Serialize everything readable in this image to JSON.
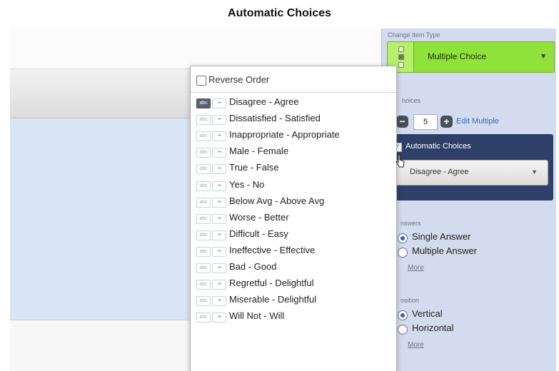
{
  "caption": "Automatic Choices",
  "panel": {
    "change_item_type_label": "Change Item Type",
    "item_type": "Multiple Choice",
    "choices_label": "hoices",
    "choices_count": "5",
    "edit_multiple": "Edit Multiple",
    "automatic_choices_label": "Automatic Choices",
    "automatic_choices_value": "Disagree - Agree",
    "answers_label": "nswers",
    "answer_options": [
      {
        "label": "Single Answer",
        "selected": true
      },
      {
        "label": "Multiple Answer",
        "selected": false
      }
    ],
    "answers_more": "More",
    "position_label": "osition",
    "position_options": [
      {
        "label": "Vertical",
        "selected": true
      },
      {
        "label": "Horizontal",
        "selected": false
      }
    ],
    "position_more": "More"
  },
  "dropdown": {
    "reverse_order": "Reverse Order",
    "tag_abc": "abc",
    "tag_dots": "•••",
    "items": [
      "Disagree - Agree",
      "Dissatisfied - Satisfied",
      "Inappropriate - Appropriate",
      "Male - Female",
      "True - False",
      "Yes - No",
      "Below Avg - Above Avg",
      "Worse - Better",
      "Difficult - Easy",
      "Ineffective - Effective",
      "Bad - Good",
      "Regretful - Delightful",
      "Miserable - Delightful",
      "Will Not - Will"
    ],
    "selected_index": 0
  },
  "colors": {
    "item_type_green": "#8ee23a",
    "auto_panel": "#2f4068",
    "link_blue": "#3466c5"
  }
}
